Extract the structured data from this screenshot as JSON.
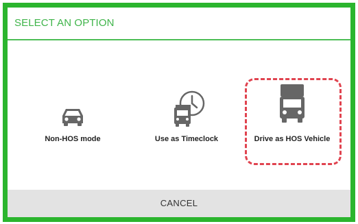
{
  "dialog": {
    "title": "SELECT AN OPTION",
    "options": [
      {
        "label": "Non-HOS mode",
        "icon": "car-icon"
      },
      {
        "label": "Use as Timeclock",
        "icon": "truck-clock-icon"
      },
      {
        "label": "Drive as HOS Vehicle",
        "icon": "truck-icon"
      }
    ],
    "cancel_label": "CANCEL"
  },
  "colors": {
    "accent_green": "#2bb52e",
    "title_green": "#3fb44a",
    "highlight_red": "#e0434f",
    "icon_gray": "#666666",
    "cancel_bg": "#e3e3e3"
  }
}
